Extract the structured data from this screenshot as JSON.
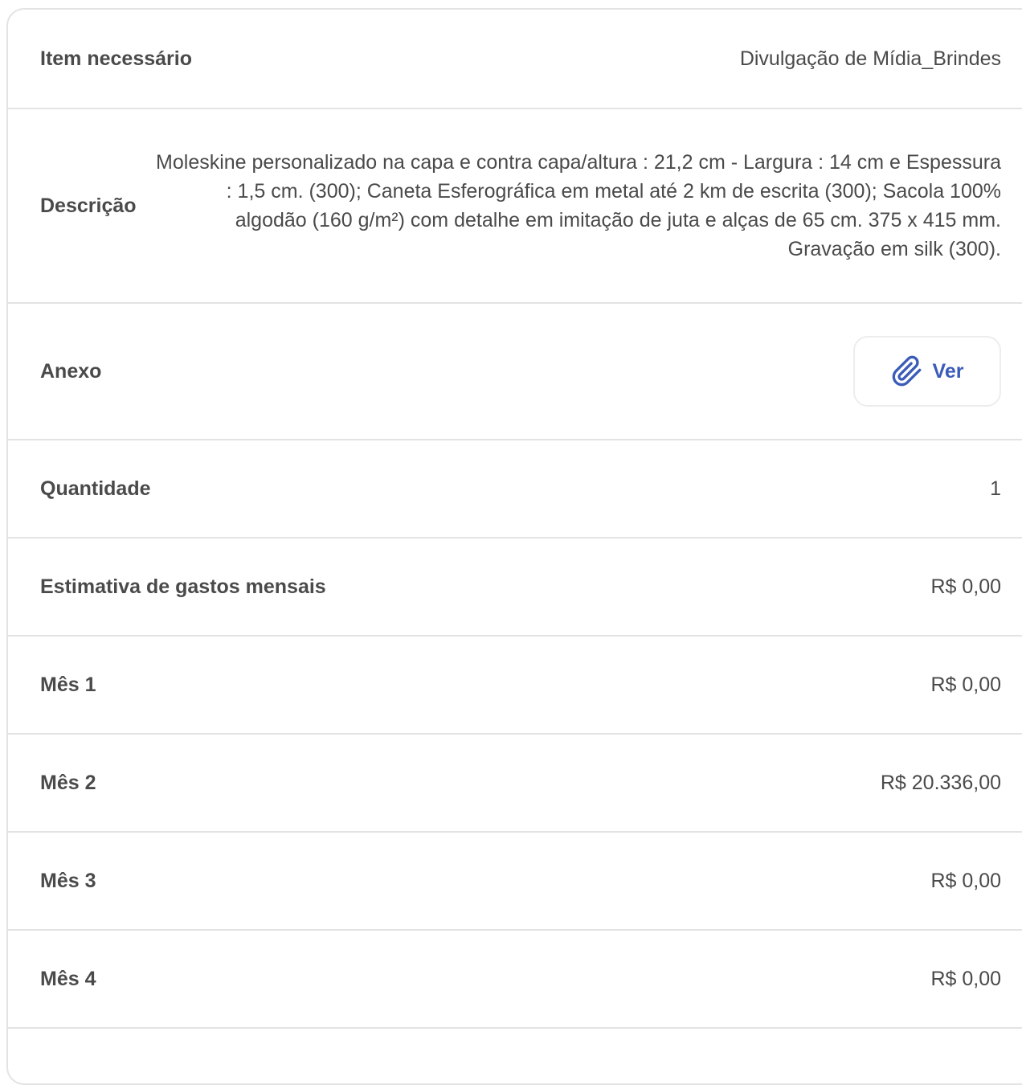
{
  "details": {
    "item": {
      "label": "Item necessário",
      "value": "Divulgação de Mídia_Brindes"
    },
    "description": {
      "label": "Descrição",
      "value": "Moleskine personalizado na capa e contra capa/altura : 21,2 cm - Largura : 14 cm e Espessura : 1,5 cm. (300); Caneta Esferográfica em metal até 2 km de escrita (300); Sacola 100% algodão (160 g/m²) com detalhe em imitação de juta e alças de 65 cm. 375 x 415 mm. Gravação em silk (300)."
    },
    "attachment": {
      "label": "Anexo",
      "button_label": "Ver",
      "icon": "paperclip-icon",
      "accent": "#3b5cb8"
    },
    "quantity": {
      "label": "Quantidade",
      "value": "1"
    },
    "monthly_estimate": {
      "label": "Estimativa de gastos mensais",
      "value": "R$ 0,00"
    },
    "months": [
      {
        "label": "Mês 1",
        "value": "R$ 0,00"
      },
      {
        "label": "Mês 2",
        "value": "R$ 20.336,00"
      },
      {
        "label": "Mês 3",
        "value": "R$ 0,00"
      },
      {
        "label": "Mês 4",
        "value": "R$ 0,00"
      }
    ]
  }
}
